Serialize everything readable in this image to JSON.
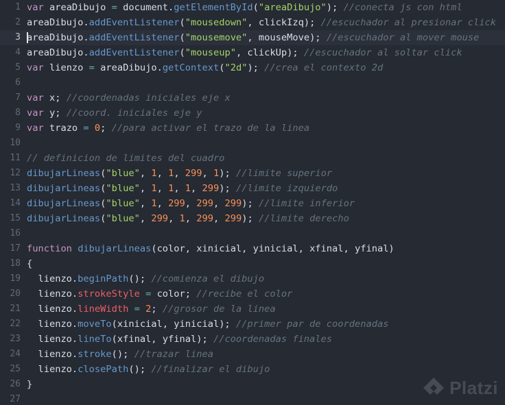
{
  "colors": {
    "background": "#262a33",
    "keyword": "#c594c5",
    "string": "#a5d36a",
    "number": "#f99157",
    "function": "#6699cc",
    "property": "#ec5f67",
    "operator": "#5fb3b3",
    "identifier": "#d8dee9",
    "comment": "#65737e",
    "gutter": "#626a76"
  },
  "editor": {
    "cursor_line": 3,
    "lines": [
      {
        "n": "1",
        "tokens": [
          [
            "kw",
            "var"
          ],
          [
            "id",
            " areaDibujo "
          ],
          [
            "op",
            "="
          ],
          [
            "id",
            " document."
          ],
          [
            "fn",
            "getElementById"
          ],
          [
            "pun",
            "("
          ],
          [
            "str",
            "\"areaDibujo\""
          ],
          [
            "pun",
            ");"
          ],
          [
            "com",
            " //conecta js con html"
          ]
        ]
      },
      {
        "n": "2",
        "tokens": [
          [
            "id",
            "areaDibujo."
          ],
          [
            "fn",
            "addEventListener"
          ],
          [
            "pun",
            "("
          ],
          [
            "str",
            "\"mousedown\""
          ],
          [
            "pun",
            ", clickIzq);"
          ],
          [
            "com",
            " //escuchador al presionar click"
          ]
        ]
      },
      {
        "n": "3",
        "tokens": [
          [
            "id",
            "areaDibujo."
          ],
          [
            "fn",
            "addEventListener"
          ],
          [
            "pun",
            "("
          ],
          [
            "str",
            "\"mousemove\""
          ],
          [
            "pun",
            ", mouseMove);"
          ],
          [
            "com",
            " //escuchador al mover mouse"
          ]
        ]
      },
      {
        "n": "4",
        "tokens": [
          [
            "id",
            "areaDibujo."
          ],
          [
            "fn",
            "addEventListener"
          ],
          [
            "pun",
            "("
          ],
          [
            "str",
            "\"mouseup\""
          ],
          [
            "pun",
            ", clickUp);"
          ],
          [
            "com",
            " //escuchador al soltar click"
          ]
        ]
      },
      {
        "n": "5",
        "tokens": [
          [
            "kw",
            "var"
          ],
          [
            "id",
            " lienzo "
          ],
          [
            "op",
            "="
          ],
          [
            "id",
            " areaDibujo."
          ],
          [
            "fn",
            "getContext"
          ],
          [
            "pun",
            "("
          ],
          [
            "str",
            "\"2d\""
          ],
          [
            "pun",
            ");"
          ],
          [
            "com",
            " //crea el contexto 2d"
          ]
        ]
      },
      {
        "n": "6",
        "tokens": []
      },
      {
        "n": "7",
        "tokens": [
          [
            "kw",
            "var"
          ],
          [
            "id",
            " x;"
          ],
          [
            "com",
            " //coordenadas iniciales eje x"
          ]
        ]
      },
      {
        "n": "8",
        "tokens": [
          [
            "kw",
            "var"
          ],
          [
            "id",
            " y;"
          ],
          [
            "com",
            " //coord. iniciales eje y"
          ]
        ]
      },
      {
        "n": "9",
        "tokens": [
          [
            "kw",
            "var"
          ],
          [
            "id",
            " trazo "
          ],
          [
            "op",
            "="
          ],
          [
            "id",
            " "
          ],
          [
            "num",
            "0"
          ],
          [
            "pun",
            ";"
          ],
          [
            "com",
            " //para activar el trazo de la linea"
          ]
        ]
      },
      {
        "n": "10",
        "tokens": []
      },
      {
        "n": "11",
        "tokens": [
          [
            "com",
            "// definicion de limites del cuadro"
          ]
        ]
      },
      {
        "n": "12",
        "tokens": [
          [
            "fn",
            "dibujarLineas"
          ],
          [
            "pun",
            "("
          ],
          [
            "str",
            "\"blue\""
          ],
          [
            "pun",
            ", "
          ],
          [
            "num",
            "1"
          ],
          [
            "pun",
            ", "
          ],
          [
            "num",
            "1"
          ],
          [
            "pun",
            ", "
          ],
          [
            "num",
            "299"
          ],
          [
            "pun",
            ", "
          ],
          [
            "num",
            "1"
          ],
          [
            "pun",
            ");"
          ],
          [
            "com",
            " //limite superior"
          ]
        ]
      },
      {
        "n": "13",
        "tokens": [
          [
            "fn",
            "dibujarLineas"
          ],
          [
            "pun",
            "("
          ],
          [
            "str",
            "\"blue\""
          ],
          [
            "pun",
            ", "
          ],
          [
            "num",
            "1"
          ],
          [
            "pun",
            ", "
          ],
          [
            "num",
            "1"
          ],
          [
            "pun",
            ", "
          ],
          [
            "num",
            "1"
          ],
          [
            "pun",
            ", "
          ],
          [
            "num",
            "299"
          ],
          [
            "pun",
            ");"
          ],
          [
            "com",
            " //limite izquierdo"
          ]
        ]
      },
      {
        "n": "14",
        "tokens": [
          [
            "fn",
            "dibujarLineas"
          ],
          [
            "pun",
            "("
          ],
          [
            "str",
            "\"blue\""
          ],
          [
            "pun",
            ", "
          ],
          [
            "num",
            "1"
          ],
          [
            "pun",
            ", "
          ],
          [
            "num",
            "299"
          ],
          [
            "pun",
            ", "
          ],
          [
            "num",
            "299"
          ],
          [
            "pun",
            ", "
          ],
          [
            "num",
            "299"
          ],
          [
            "pun",
            ");"
          ],
          [
            "com",
            " //limite inferior"
          ]
        ]
      },
      {
        "n": "15",
        "tokens": [
          [
            "fn",
            "dibujarLineas"
          ],
          [
            "pun",
            "("
          ],
          [
            "str",
            "\"blue\""
          ],
          [
            "pun",
            ", "
          ],
          [
            "num",
            "299"
          ],
          [
            "pun",
            ", "
          ],
          [
            "num",
            "1"
          ],
          [
            "pun",
            ", "
          ],
          [
            "num",
            "299"
          ],
          [
            "pun",
            ", "
          ],
          [
            "num",
            "299"
          ],
          [
            "pun",
            ");"
          ],
          [
            "com",
            " //limite derecho"
          ]
        ]
      },
      {
        "n": "16",
        "tokens": []
      },
      {
        "n": "17",
        "tokens": [
          [
            "kw",
            "function"
          ],
          [
            "id",
            " "
          ],
          [
            "fn",
            "dibujarLineas"
          ],
          [
            "pun",
            "(color, xinicial, yinicial, xfinal, yfinal)"
          ]
        ]
      },
      {
        "n": "18",
        "tokens": [
          [
            "pun",
            "{"
          ]
        ]
      },
      {
        "n": "19",
        "tokens": [
          [
            "id",
            "  lienzo."
          ],
          [
            "fn",
            "beginPath"
          ],
          [
            "pun",
            "();"
          ],
          [
            "com",
            " //comienza el dibujo"
          ]
        ]
      },
      {
        "n": "20",
        "tokens": [
          [
            "id",
            "  lienzo."
          ],
          [
            "prop",
            "strokeStyle"
          ],
          [
            "id",
            " "
          ],
          [
            "op",
            "="
          ],
          [
            "id",
            " color;"
          ],
          [
            "com",
            " //recibe el color"
          ]
        ]
      },
      {
        "n": "21",
        "tokens": [
          [
            "id",
            "  lienzo."
          ],
          [
            "prop",
            "lineWidth"
          ],
          [
            "id",
            " "
          ],
          [
            "op",
            "="
          ],
          [
            "id",
            " "
          ],
          [
            "num",
            "2"
          ],
          [
            "pun",
            ";"
          ],
          [
            "com",
            " //grosor de la linea"
          ]
        ]
      },
      {
        "n": "22",
        "tokens": [
          [
            "id",
            "  lienzo."
          ],
          [
            "fn",
            "moveTo"
          ],
          [
            "pun",
            "(xinicial, yinicial);"
          ],
          [
            "com",
            " //primer par de coordenadas"
          ]
        ]
      },
      {
        "n": "23",
        "tokens": [
          [
            "id",
            "  lienzo."
          ],
          [
            "fn",
            "lineTo"
          ],
          [
            "pun",
            "(xfinal, yfinal);"
          ],
          [
            "com",
            " //coordenadas finales"
          ]
        ]
      },
      {
        "n": "24",
        "tokens": [
          [
            "id",
            "  lienzo."
          ],
          [
            "fn",
            "stroke"
          ],
          [
            "pun",
            "();"
          ],
          [
            "com",
            " //trazar linea"
          ]
        ]
      },
      {
        "n": "25",
        "tokens": [
          [
            "id",
            "  lienzo."
          ],
          [
            "fn",
            "closePath"
          ],
          [
            "pun",
            "();"
          ],
          [
            "com",
            " //finalizar el dibujo"
          ]
        ]
      },
      {
        "n": "26",
        "tokens": [
          [
            "pun",
            "}"
          ]
        ]
      },
      {
        "n": "27",
        "tokens": []
      }
    ]
  },
  "watermark": {
    "text": "Platzi",
    "icon": "platzi-logo-icon"
  }
}
